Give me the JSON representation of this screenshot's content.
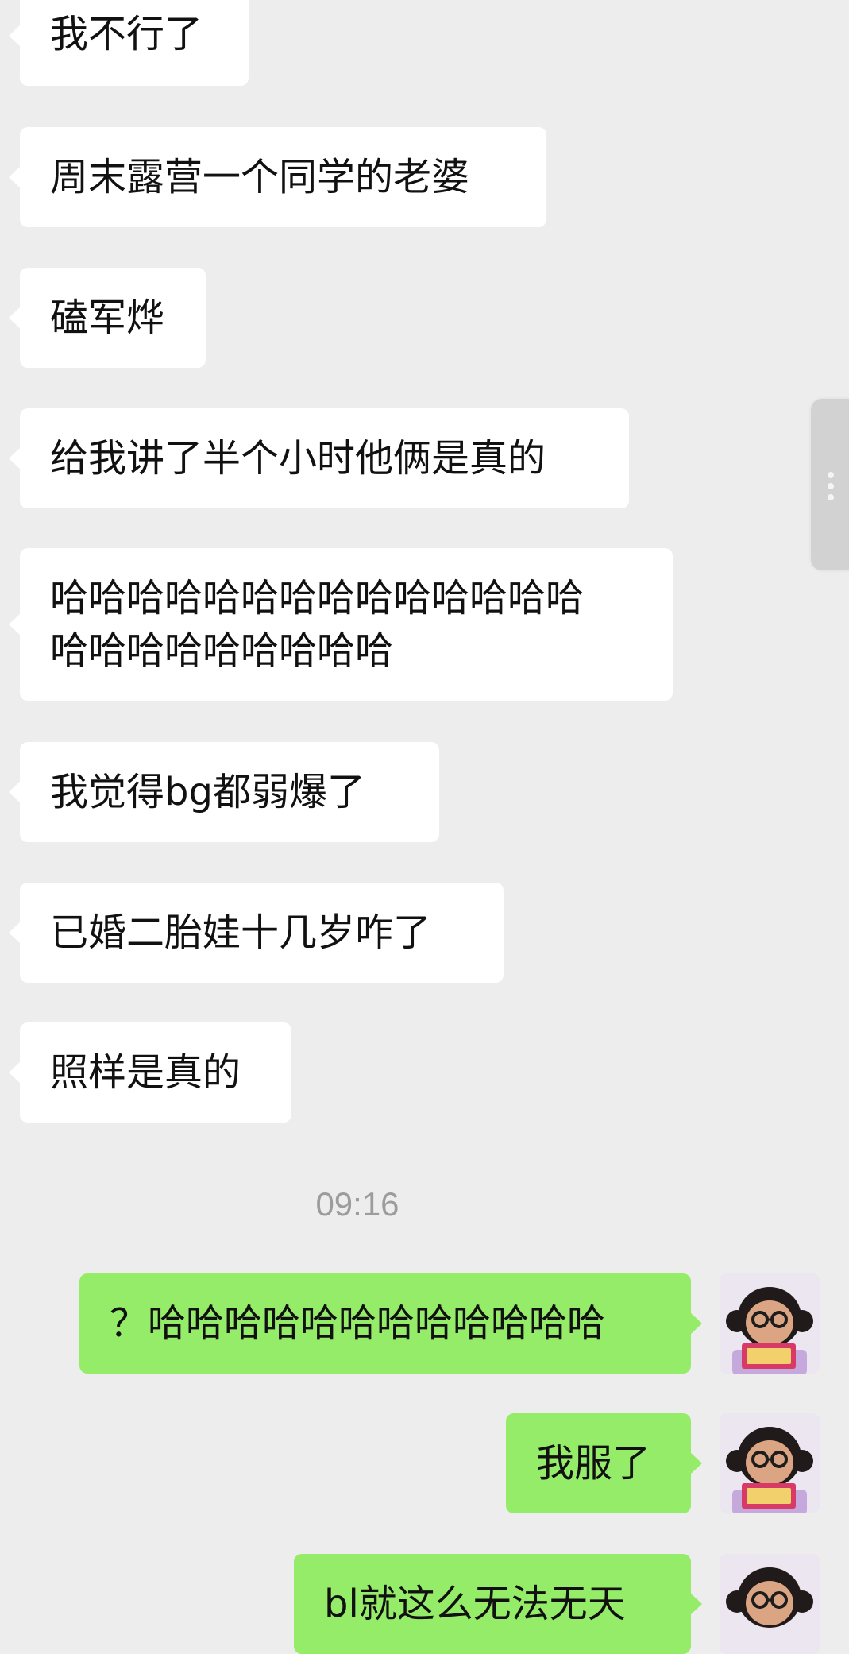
{
  "colors": {
    "background": "#ededed",
    "incoming_bubble": "#ffffff",
    "outgoing_bubble": "#95ec69",
    "timestamp_text": "#9c9c9c",
    "message_text": "#111111"
  },
  "messages_incoming": [
    {
      "text": "我不行了"
    },
    {
      "text": "周末露营一个同学的老婆"
    },
    {
      "text": "磕军烨"
    },
    {
      "text": "给我讲了半个小时他俩是真的"
    },
    {
      "text": "哈哈哈哈哈哈哈哈哈哈哈哈哈哈\n哈哈哈哈哈哈哈哈哈"
    },
    {
      "text": "我觉得bg都弱爆了"
    },
    {
      "text": "已婚二胎娃十几岁咋了"
    },
    {
      "text": "照样是真的"
    }
  ],
  "timestamp": "09:16",
  "messages_outgoing": [
    {
      "text": "？哈哈哈哈哈哈哈哈哈哈哈哈"
    },
    {
      "text": "我服了"
    },
    {
      "text": "bl就这么无法无天"
    }
  ],
  "avatar": {
    "icon": "girl-with-glasses-avatar-icon"
  },
  "scroll_handle": {
    "icon": "vertical-dots-icon"
  }
}
